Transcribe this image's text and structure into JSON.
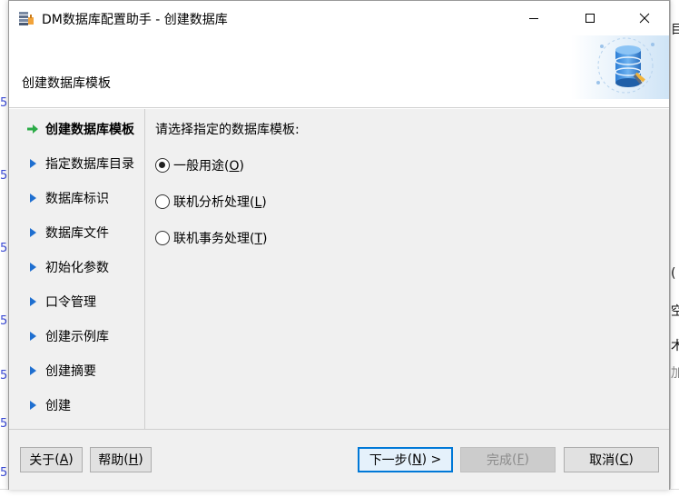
{
  "window": {
    "title": "DM数据库配置助手 - 创建数据库",
    "header_title": "创建数据库模板",
    "controls": {
      "minimize": "minimize-icon",
      "maximize": "maximize-icon",
      "close": "close-icon"
    }
  },
  "nav": {
    "items": [
      {
        "label": "创建数据库模板",
        "active": true,
        "icon": "arrow-right-icon"
      },
      {
        "label": "指定数据库目录",
        "active": false,
        "icon": "triangle-right-icon"
      },
      {
        "label": "数据库标识",
        "active": false,
        "icon": "triangle-right-icon"
      },
      {
        "label": "数据库文件",
        "active": false,
        "icon": "triangle-right-icon"
      },
      {
        "label": "初始化参数",
        "active": false,
        "icon": "triangle-right-icon"
      },
      {
        "label": "口令管理",
        "active": false,
        "icon": "triangle-right-icon"
      },
      {
        "label": "创建示例库",
        "active": false,
        "icon": "triangle-right-icon"
      },
      {
        "label": "创建摘要",
        "active": false,
        "icon": "triangle-right-icon"
      },
      {
        "label": "创建",
        "active": false,
        "icon": "triangle-right-icon"
      }
    ]
  },
  "content": {
    "prompt": "请选择指定的数据库模板:",
    "options": [
      {
        "label": "一般用途",
        "mnemonic": "O",
        "checked": true
      },
      {
        "label": "联机分析处理",
        "mnemonic": "L",
        "checked": false
      },
      {
        "label": "联机事务处理",
        "mnemonic": "T",
        "checked": false
      }
    ]
  },
  "footer": {
    "about": {
      "label": "关于",
      "mnemonic": "A"
    },
    "help": {
      "label": "帮助",
      "mnemonic": "H"
    },
    "next": {
      "label": "下一步",
      "mnemonic": "N",
      "suffix": " >"
    },
    "finish": {
      "label": "完成",
      "mnemonic": "F",
      "disabled": true
    },
    "cancel": {
      "label": "取消",
      "mnemonic": "C"
    }
  },
  "background": {
    "left_glyphs": [
      "5",
      "5",
      "5",
      "5",
      "5",
      "5",
      "5"
    ],
    "right_glyphs": [
      "目",
      "(",
      "空",
      "术",
      "加"
    ]
  },
  "colors": {
    "accent": "#0078d7",
    "nav_arrow_active": "#2bab47",
    "nav_triangle": "#1f6fd0",
    "panel_bg": "#f0f0f0"
  }
}
